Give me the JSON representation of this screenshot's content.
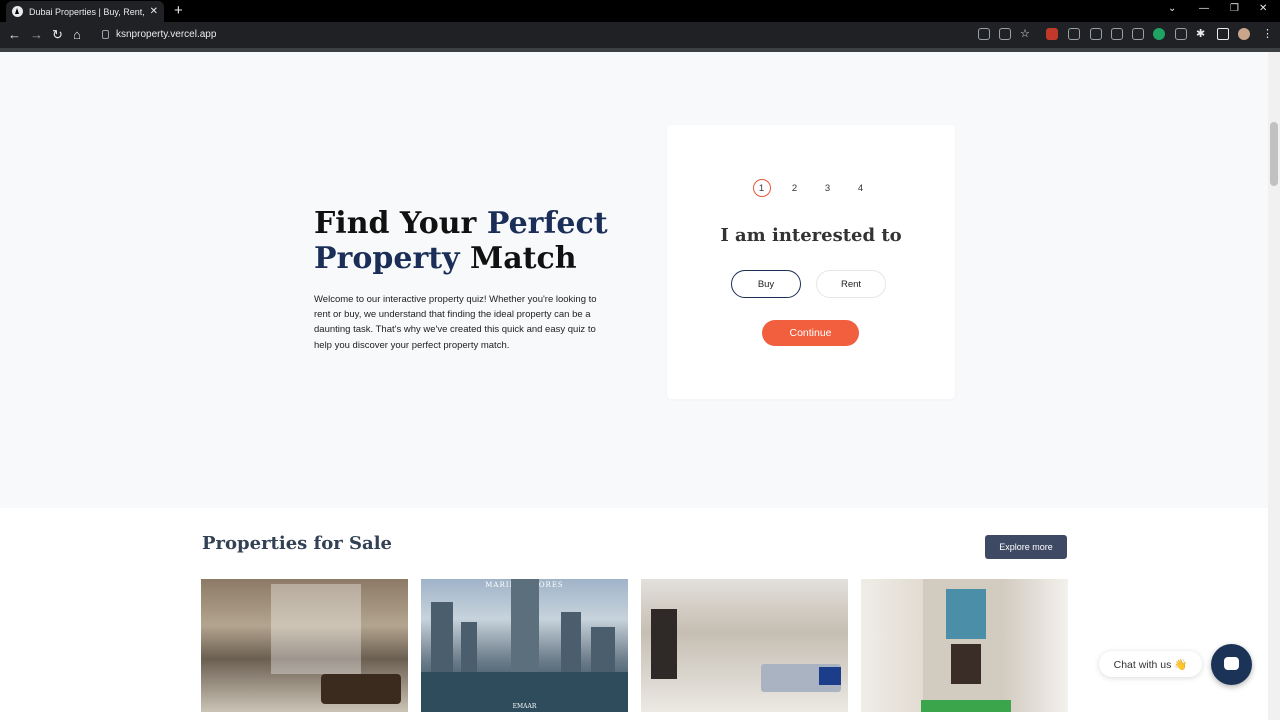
{
  "browser": {
    "tab_title": "Dubai Properties | Buy, Rent, and",
    "tab_close": "✕",
    "new_tab": "+",
    "url": "ksnproperty.vercel.app",
    "controls": {
      "minimize": "—",
      "restore": "❐",
      "close": "✕",
      "dropdown": "⌄"
    },
    "nav": {
      "back": "←",
      "forward": "→",
      "reload": "↻",
      "home": "⌂"
    }
  },
  "hero": {
    "title_part1": "Find Your ",
    "title_highlight1": "Perfect",
    "title_highlight2": "Property",
    "title_part2": " Match",
    "description": "Welcome to our interactive property quiz! Whether you're looking to rent or buy, we understand that finding the ideal property can be a daunting task. That's why we've created this quick and easy quiz to help you discover your perfect property match."
  },
  "quiz": {
    "steps": [
      "1",
      "2",
      "3",
      "4"
    ],
    "active_step": 1,
    "question": "I am interested to",
    "options": {
      "buy": "Buy",
      "rent": "Rent"
    },
    "continue": "Continue"
  },
  "sale": {
    "title": "Properties for Sale",
    "explore": "Explore more",
    "card2_brand": "MARINA SHORES",
    "card2_footer": "EMAAR"
  },
  "chat": {
    "label": "Chat with us 👋"
  },
  "colors": {
    "accent": "#f15f3f",
    "navy": "#1b2e57",
    "button_dark": "#3e4a63"
  }
}
